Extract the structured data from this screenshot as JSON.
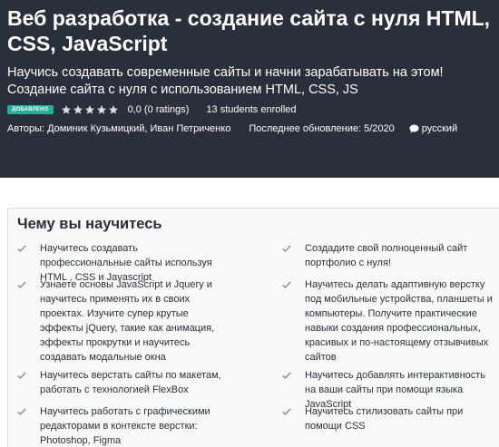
{
  "course": {
    "title": "Веб разработка - создание сайта с нуля HTML, CSS, JavaScript",
    "subtitle": "Научись создавать современные сайты и начни зарабатывать на этом! Создание сайта с нуля с использованием HTML, CSS, JS",
    "badge": "ДОБАВЛЕНО",
    "rating_text": "0,0 (0 ratings)",
    "rating_stars": 0,
    "students": "13 students enrolled",
    "authors": "Авторы: Доминик Кузьмицкий, Иван Петриченко",
    "last_update": "Последнее обновление: 5/2020",
    "language": "русский",
    "language_icon": "speech-bubble-icon"
  },
  "learn": {
    "heading": "Чему вы научитесь",
    "check_icon": "check-icon",
    "items": [
      "Научитесь создавать профессиональные сайты используя HTML , CSS и Javascript",
      "Создадите свой полноценный сайт портфолио с нуля!",
      "Узнаете основы JavaScript и Jquery и научитесь применять их в своих проектах. Изучите супер крутые эффекты jQuery, такие как анимация, эффекты прокрутки и научитесь создавать модальные окна",
      "Научитесь делать адаптивную верстку под мобильные устройства, планшеты и компьютеры. Получите практические навыки создания профессиональных, красивых и по-настоящему отзывчивых сайтов",
      "Научитесь верстать сайты по макетам, работать с технологией FlexBox",
      "Научитесь добавлять интерактивность на ваши сайты при помощи языка JavaScript",
      "Научитесь работать с графическими редакторами в контексте верстки: Photoshop, Figma",
      "Научитесь стилизовать сайты при помощи CSS"
    ]
  },
  "colors": {
    "hero_bg": "#29303b",
    "badge_bg": "#1fb299",
    "star_empty": "#dedfe0",
    "check": "#8a92a3"
  }
}
